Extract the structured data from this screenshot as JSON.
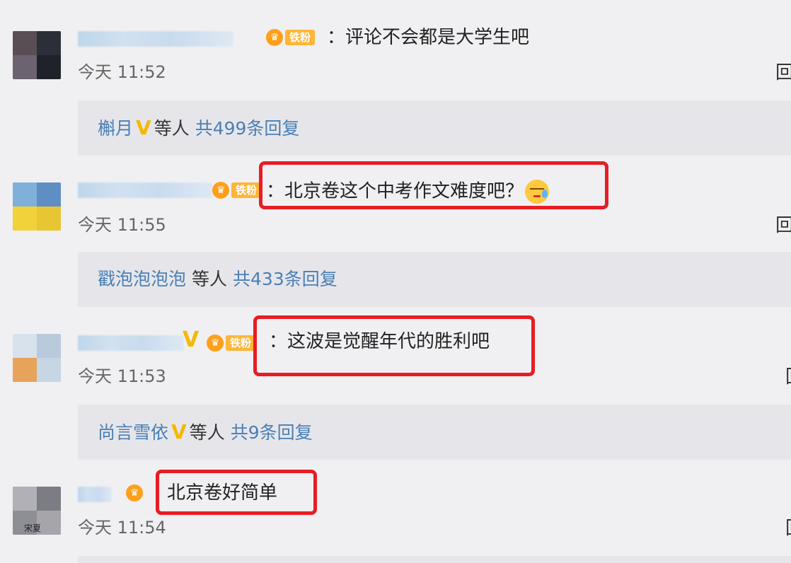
{
  "comments": [
    {
      "text": "：评论不会都是大学生吧",
      "time": "今天 11:52",
      "reply_cut": "回",
      "badge": "铁粉",
      "replies": {
        "user": "槲月",
        "etc": "等人",
        "count": "共499条回复"
      }
    },
    {
      "text": "：北京卷这个中考作文难度吧？",
      "time": "今天 11:55",
      "reply_cut": "回",
      "badge": "铁粉",
      "replies": {
        "user": "戳泡泡泡泡",
        "etc": "等人",
        "count": "共433条回复"
      }
    },
    {
      "text": "：这波是觉醒年代的胜利吧",
      "time": "今天 11:53",
      "reply_cut": "回",
      "badge": "铁粉",
      "replies": {
        "user": "尚言雪依",
        "etc": "等人",
        "count": "共9条回复"
      }
    },
    {
      "text": "北京卷好简单",
      "time": "今天 11:54",
      "reply_cut": "回",
      "avatar_caption": "宋夏"
    }
  ],
  "icons": {
    "verified": "V",
    "crown": "♛",
    "emoji": "sweat-emoji"
  },
  "colors": {
    "highlight": "#e81c24",
    "link": "#4a7fb5",
    "verified": "#f5b800"
  }
}
